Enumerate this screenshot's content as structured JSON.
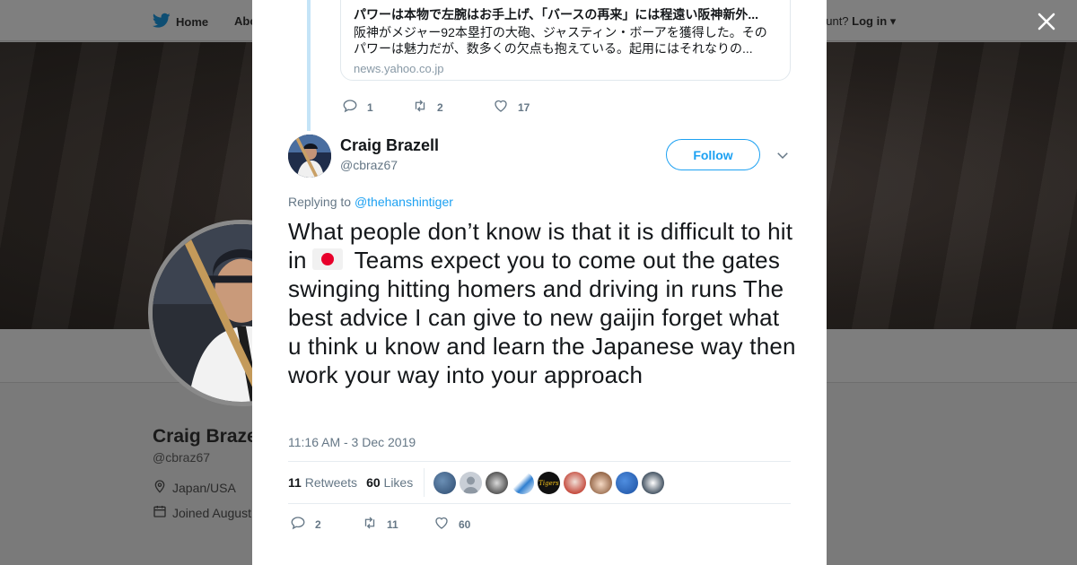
{
  "background_page": {
    "nav": {
      "home_label": "Home",
      "about_label": "Abo",
      "account_prompt": "ccount?",
      "login_label": "Log in"
    },
    "profile": {
      "name": "Craig Braze",
      "handle": "@cbraz67",
      "location": "Japan/USA",
      "joined": "Joined August"
    }
  },
  "modal": {
    "quoted_card": {
      "title": "パワーは本物で左腕はお手上げ、「バースの再来」には程遠い阪神新外...",
      "description": "阪神がメジャー92本塁打の大砲、ジャスティン・ボーアを獲得した。そのパワーは魅力だが、数多くの欠点も抱えている。起用にはそれなりの...",
      "domain": "news.yahoo.co.jp"
    },
    "previous_tweet_actions": {
      "replies": "1",
      "retweets": "2",
      "likes": "17"
    },
    "tweet": {
      "author_name": "Craig Brazell",
      "author_handle": "@cbraz67",
      "follow_label": "Follow",
      "replying_prefix": "Replying to",
      "replying_to": "@thehanshintiger",
      "text_part1": "What people don’t know is that it is difficult to hit in",
      "text_part2": "Teams expect you to come out the gates swinging hitting homers and driving in runs   The best advice I can give to new gaijin forget what u think u know and learn the Japanese way then work your way into your approach",
      "timestamp": "11:16 AM - 3 Dec 2019",
      "retweet_count": "11",
      "retweet_label": "Retweets",
      "like_count": "60",
      "like_label": "Likes",
      "actions": {
        "replies": "2",
        "retweets": "11",
        "likes": "60"
      }
    }
  },
  "colors": {
    "accent": "#1da1f2",
    "text_primary": "#14171a",
    "text_secondary": "#657786",
    "thread_line": "#c4e4f7"
  },
  "icons": [
    "twitter-bird-icon",
    "close-icon",
    "reply-icon",
    "retweet-icon",
    "heart-icon",
    "chevron-down-icon",
    "location-icon",
    "calendar-icon",
    "japan-flag-emoji"
  ]
}
